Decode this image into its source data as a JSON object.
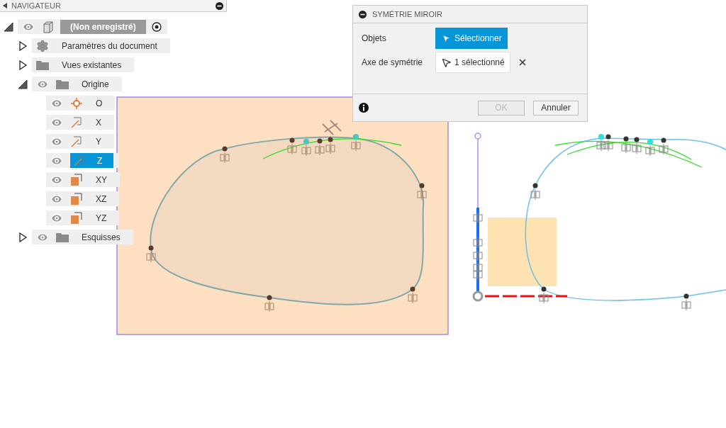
{
  "navigator": {
    "title": "NAVIGATEUR",
    "items": [
      {
        "label": "(Non enregistré)",
        "kind": "component",
        "expanded": true,
        "visible": true,
        "active": true,
        "children": [
          {
            "label": "Paramètres du document",
            "kind": "settings",
            "expanded": false,
            "visible": false,
            "selected": false
          },
          {
            "label": "Vues existantes",
            "kind": "folder",
            "expanded": false,
            "visible": false,
            "selected": false
          },
          {
            "label": "Origine",
            "kind": "folder",
            "expanded": true,
            "visible": true,
            "selected": false,
            "children": [
              {
                "label": "O",
                "kind": "point",
                "visible": true,
                "selected": false
              },
              {
                "label": "X",
                "kind": "axis",
                "visible": true,
                "selected": false
              },
              {
                "label": "Y",
                "kind": "axis",
                "visible": true,
                "selected": false
              },
              {
                "label": "Z",
                "kind": "axis",
                "visible": true,
                "selected": true
              },
              {
                "label": "XY",
                "kind": "plane",
                "visible": true,
                "selected": false
              },
              {
                "label": "XZ",
                "kind": "plane",
                "visible": true,
                "selected": false
              },
              {
                "label": "YZ",
                "kind": "plane",
                "visible": true,
                "selected": false
              }
            ]
          },
          {
            "label": "Esquisses",
            "kind": "folder",
            "expanded": false,
            "visible": true,
            "selected": false
          }
        ]
      }
    ]
  },
  "dialog": {
    "title": "SYMÉTRIE MIROIR",
    "rows": [
      {
        "label": "Objets",
        "button": "Sélectionner",
        "selected": true,
        "clearable": false
      },
      {
        "label": "Axe de symétrie",
        "button": "1 sélectionné",
        "selected": false,
        "clearable": true
      }
    ],
    "ok": {
      "label": "OK",
      "disabled": true
    },
    "cancel": {
      "label": "Annuler"
    }
  }
}
